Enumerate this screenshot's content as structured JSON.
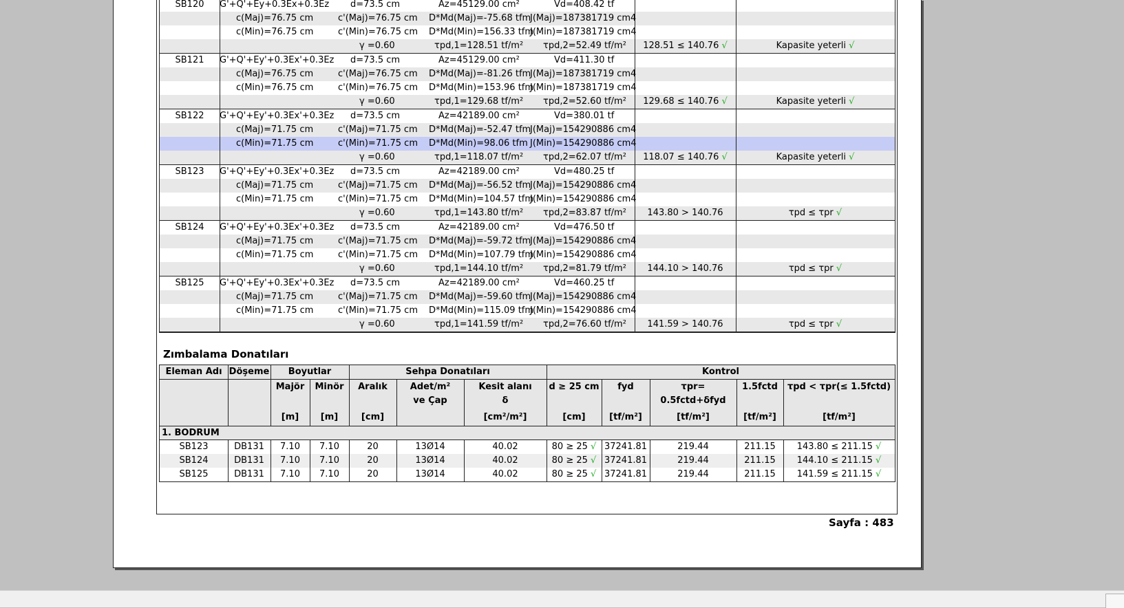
{
  "check_mark": "√",
  "shear_rows": [
    {
      "id": "SB120",
      "combo": "G'+Q'+Ey+0.3Ex+0.3Ez",
      "d": "d=73.5 cm",
      "az": "Az=45129.00 cm²",
      "vd": "Vd=408.42 tf",
      "cmaj": "c(Maj)=76.75 cm",
      "cpmaj": "c'(Maj)=76.75 cm",
      "mdmaj": "D*Md(Maj)=-75.68 tfm",
      "jmaj": "J(Maj)=187381719 cm4",
      "cmin": "c(Min)=76.75 cm",
      "cpmin": "c'(Min)=76.75 cm",
      "mdmin": "D*Md(Min)=156.33 tfm",
      "jmin": "J(Min)=187381719 cm4",
      "gamma": "γ =0.60",
      "tpd1": "τpd,1=128.51 tf/m²",
      "tpd2": "τpd,2=52.49 tf/m²",
      "ratio": "128.51 ≤ 140.76",
      "result": "Kapasite yeterli"
    },
    {
      "id": "SB121",
      "combo": "G'+Q'+Ey'+0.3Ex'+0.3Ez",
      "d": "d=73.5 cm",
      "az": "Az=45129.00 cm²",
      "vd": "Vd=411.30 tf",
      "cmaj": "c(Maj)=76.75 cm",
      "cpmaj": "c'(Maj)=76.75 cm",
      "mdmaj": "D*Md(Maj)=-81.26 tfm",
      "jmaj": "J(Maj)=187381719 cm4",
      "cmin": "c(Min)=76.75 cm",
      "cpmin": "c'(Min)=76.75 cm",
      "mdmin": "D*Md(Min)=153.96 tfm",
      "jmin": "J(Min)=187381719 cm4",
      "gamma": "γ =0.60",
      "tpd1": "τpd,1=129.68 tf/m²",
      "tpd2": "τpd,2=52.60 tf/m²",
      "ratio": "129.68 ≤ 140.76",
      "result": "Kapasite yeterli"
    },
    {
      "id": "SB122",
      "combo": "G'+Q'+Ey'+0.3Ex'+0.3Ez",
      "d": "d=73.5 cm",
      "az": "Az=42189.00 cm²",
      "vd": "Vd=380.01 tf",
      "cmaj": "c(Maj)=71.75 cm",
      "cpmaj": "c'(Maj)=71.75 cm",
      "mdmaj": "D*Md(Maj)=-52.47 tfm",
      "jmaj": "J(Maj)=154290886 cm4",
      "cmin": "c(Min)=71.75 cm",
      "cpmin": "c'(Min)=71.75 cm",
      "mdmin": "D*Md(Min)=98.06 tfm",
      "jmin": "J(Min)=154290886 cm4",
      "gamma": "γ =0.60",
      "tpd1": "τpd,1=118.07 tf/m²",
      "tpd2": "τpd,2=62.07 tf/m²",
      "ratio": "118.07 ≤ 140.76",
      "result": "Kapasite yeterli"
    },
    {
      "id": "SB123",
      "combo": "G'+Q'+Ey'+0.3Ex'+0.3Ez",
      "d": "d=73.5 cm",
      "az": "Az=42189.00 cm²",
      "vd": "Vd=480.25 tf",
      "cmaj": "c(Maj)=71.75 cm",
      "cpmaj": "c'(Maj)=71.75 cm",
      "mdmaj": "D*Md(Maj)=-56.52 tfm",
      "jmaj": "J(Maj)=154290886 cm4",
      "cmin": "c(Min)=71.75 cm",
      "cpmin": "c'(Min)=71.75 cm",
      "mdmin": "D*Md(Min)=104.57 tfm",
      "jmin": "J(Min)=154290886 cm4",
      "gamma": "γ =0.60",
      "tpd1": "τpd,1=143.80 tf/m²",
      "tpd2": "τpd,2=83.87 tf/m²",
      "ratio": "143.80 > 140.76",
      "result": "τpd ≤ τpr"
    },
    {
      "id": "SB124",
      "combo": "G'+Q'+Ey'+0.3Ex'+0.3Ez",
      "d": "d=73.5 cm",
      "az": "Az=42189.00 cm²",
      "vd": "Vd=476.50 tf",
      "cmaj": "c(Maj)=71.75 cm",
      "cpmaj": "c'(Maj)=71.75 cm",
      "mdmaj": "D*Md(Maj)=-59.72 tfm",
      "jmaj": "J(Maj)=154290886 cm4",
      "cmin": "c(Min)=71.75 cm",
      "cpmin": "c'(Min)=71.75 cm",
      "mdmin": "D*Md(Min)=107.79 tfm",
      "jmin": "J(Min)=154290886 cm4",
      "gamma": "γ =0.60",
      "tpd1": "τpd,1=144.10 tf/m²",
      "tpd2": "τpd,2=81.79 tf/m²",
      "ratio": "144.10 > 140.76",
      "result": "τpd ≤ τpr"
    },
    {
      "id": "SB125",
      "combo": "G'+Q'+Ey'+0.3Ex'+0.3Ez",
      "d": "d=73.5 cm",
      "az": "Az=42189.00 cm²",
      "vd": "Vd=460.25 tf",
      "cmaj": "c(Maj)=71.75 cm",
      "cpmaj": "c'(Maj)=71.75 cm",
      "mdmaj": "D*Md(Maj)=-59.60 tfm",
      "jmaj": "J(Maj)=154290886 cm4",
      "cmin": "c(Min)=71.75 cm",
      "cpmin": "c'(Min)=71.75 cm",
      "mdmin": "D*Md(Min)=115.09 tfm",
      "jmin": "J(Min)=154290886 cm4",
      "gamma": "γ =0.60",
      "tpd1": "τpd,1=141.59 tf/m²",
      "tpd2": "τpd,2=76.60 tf/m²",
      "ratio": "141.59 > 140.76",
      "result": "τpd ≤ τpr"
    }
  ],
  "reinforcement": {
    "title": "Zımbalama Donatıları",
    "headers": {
      "eleman": "Eleman Adı",
      "doseme": "Döşeme",
      "boyutlar": "Boyutlar",
      "major": "Majör",
      "minor": "Minör",
      "sehpa": "Sehpa Donatıları",
      "aralik": "Aralık",
      "adet1": "Adet/m²",
      "adet2": "ve Çap",
      "kesit1": "Kesit alanı",
      "kesit2": "δ",
      "kontrol": "Kontrol",
      "d25": "d ≥ 25 cm",
      "fyd": "fyd",
      "tpr1": "τpr=",
      "tpr2": "0.5fctd+δfyd",
      "f15": "1.5fctd",
      "tcheck": "τpd < τpr(≤ 1.5fctd)"
    },
    "units": {
      "major": "[m]",
      "minor": "[m]",
      "aralik": "[cm]",
      "kesit": "[cm²/m²]",
      "d25": "[cm]",
      "fyd": "[tf/m²]",
      "tpr": "[tf/m²]",
      "f15": "[tf/m²]",
      "tcheck": "[tf/m²]"
    },
    "group": "1. BODRUM",
    "rows": [
      {
        "eleman": "SB123",
        "doseme": "DB131",
        "major": "7.10",
        "minor": "7.10",
        "aralik": "20",
        "adet": "13Ø14",
        "kesit": "40.02",
        "d25": "80 ≥ 25",
        "fyd": "37241.81",
        "tpr": "219.44",
        "f15": "211.15",
        "tcheck": "143.80 ≤ 211.15"
      },
      {
        "eleman": "SB124",
        "doseme": "DB131",
        "major": "7.10",
        "minor": "7.10",
        "aralik": "20",
        "adet": "13Ø14",
        "kesit": "40.02",
        "d25": "80 ≥ 25",
        "fyd": "37241.81",
        "tpr": "219.44",
        "f15": "211.15",
        "tcheck": "144.10 ≤ 211.15"
      },
      {
        "eleman": "SB125",
        "doseme": "DB131",
        "major": "7.10",
        "minor": "7.10",
        "aralik": "20",
        "adet": "13Ø14",
        "kesit": "40.02",
        "d25": "80 ≥ 25",
        "fyd": "37241.81",
        "tpr": "219.44",
        "f15": "211.15",
        "tcheck": "141.59 ≤ 211.15"
      }
    ]
  },
  "page_label": "Sayfa : 483"
}
